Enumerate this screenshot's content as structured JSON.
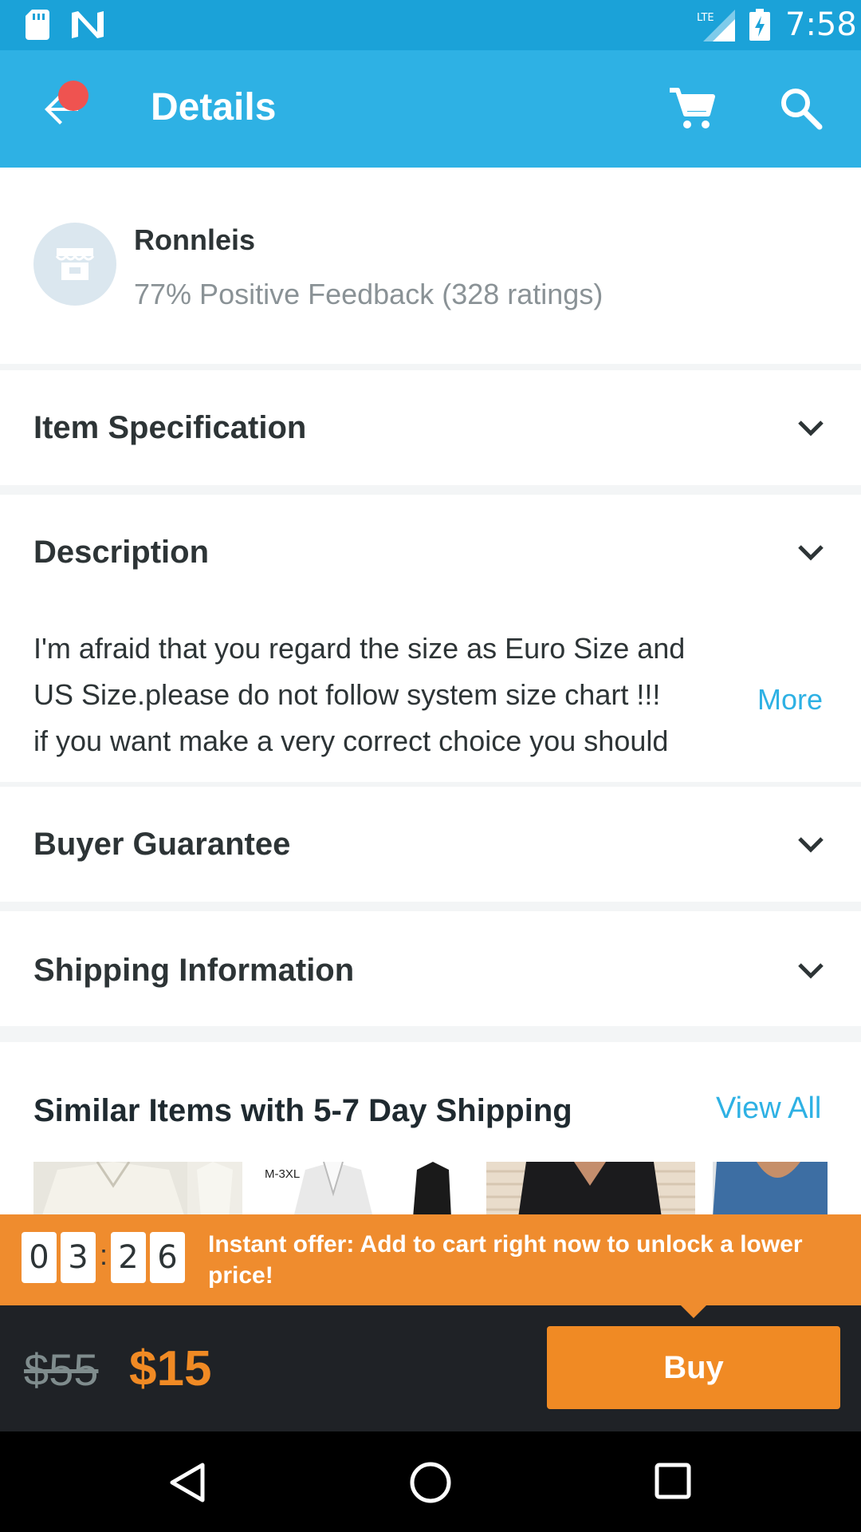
{
  "status_bar": {
    "time": "7:58",
    "network": "LTE"
  },
  "app_bar": {
    "title": "Details"
  },
  "store": {
    "name": "Ronnleis",
    "feedback": "77% Positive Feedback (328 ratings)"
  },
  "sections": {
    "item_specification": "Item Specification",
    "description": "Description",
    "buyer_guarantee": "Buyer Guarantee",
    "shipping_information": "Shipping Information"
  },
  "description": {
    "lines": [
      "I'm afraid that you regard the size as Euro Size and",
      "US Size.please do not follow system size chart !!!",
      "if you want make a very correct choice you should"
    ],
    "more": "More"
  },
  "similar": {
    "title": "Similar Items with 5-7 Day Shipping",
    "view_all": "View All",
    "thumb_label": "M-3XL"
  },
  "offer": {
    "timer_digits": [
      "0",
      "3",
      "2",
      "6"
    ],
    "timer_separator": ":",
    "text": "Instant offer: Add to cart right now to unlock a lower price!"
  },
  "price": {
    "original": "$55",
    "current": "$15",
    "buy_label": "Buy"
  },
  "colors": {
    "status_bar": "#1ba2d8",
    "app_bar": "#2eb1e4",
    "offer": "#ef8c2e",
    "buy_button": "#f08a24",
    "buy_bar": "#1f2226"
  }
}
